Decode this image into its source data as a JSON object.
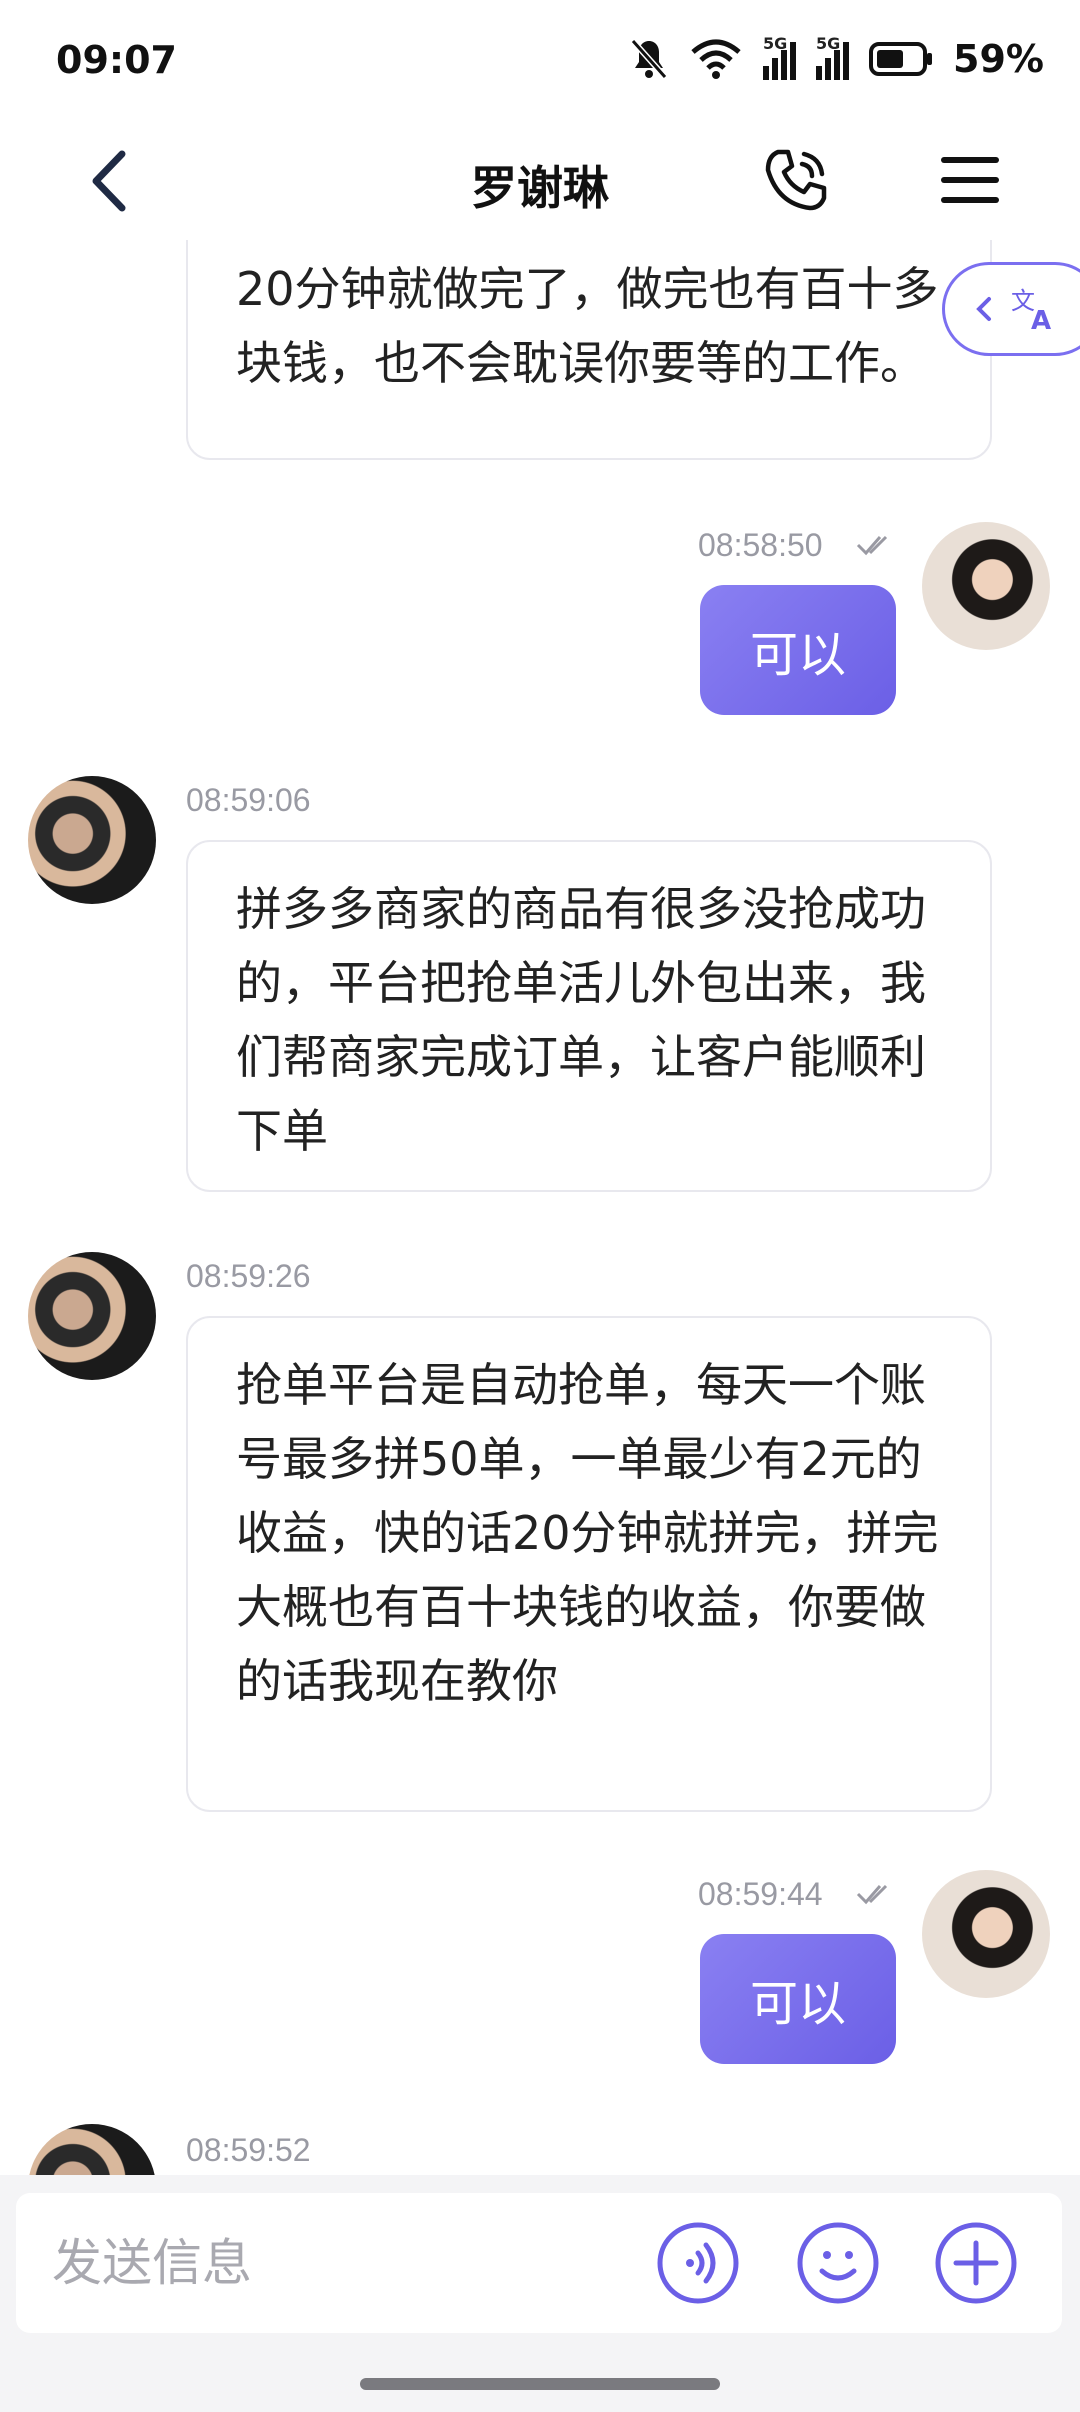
{
  "status_bar": {
    "time": "09:07",
    "battery": "59%",
    "network_1": "5G",
    "network_2": "5G"
  },
  "header": {
    "title": "罗谢琳"
  },
  "messages": [
    {
      "direction": "in",
      "text": "20分钟就做完了，做完也有百十多块钱，也不会耽误你要等的工作。"
    },
    {
      "direction": "out",
      "time": "08:58:50",
      "text": "可以"
    },
    {
      "direction": "in",
      "time": "08:59:06",
      "text": "拼多多商家的商品有很多没抢成功的，平台把抢单活儿外包出来，我们帮商家完成订单，让客户能顺利下单"
    },
    {
      "direction": "in",
      "time": "08:59:26",
      "text": "抢单平台是自动抢单，每天一个账号最多拼50单，一单最少有2元的收益，快的话20分钟就拼完，拼完大概也有百十块钱的收益，你要做的话我现在教你"
    },
    {
      "direction": "out",
      "time": "08:59:44",
      "text": "可以"
    },
    {
      "direction": "in",
      "time": "08:59:52",
      "text": ""
    }
  ],
  "composer": {
    "placeholder": "发送信息"
  },
  "colors": {
    "accent": "#6b5fe6",
    "bubble_out_start": "#8a80f2",
    "timestamp": "#999aa3"
  },
  "icons": {
    "back": "chevron-left-icon",
    "call": "phone-icon",
    "menu": "hamburger-menu-icon",
    "translate": "translate-icon",
    "voice": "voice-icon",
    "emoji": "emoji-icon",
    "add": "plus-icon"
  }
}
